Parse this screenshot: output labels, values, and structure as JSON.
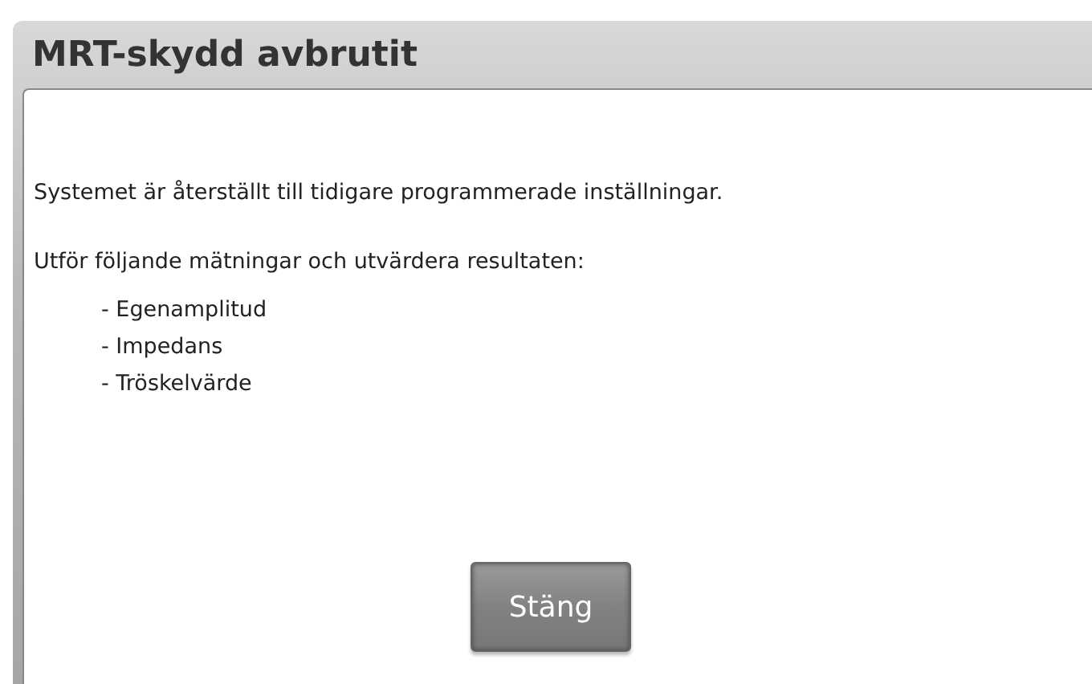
{
  "window": {
    "title": "MRT-skydd avbrutit"
  },
  "message": "Systemet är återställt till tidigare programmerade inställningar.",
  "instruction": "Utför följande mätningar och utvärdera resultaten:",
  "measurements": [
    "- Egenamplitud",
    "- Impedans",
    "- Tröskelvärde"
  ],
  "buttons": [
    "Stäng"
  ]
}
